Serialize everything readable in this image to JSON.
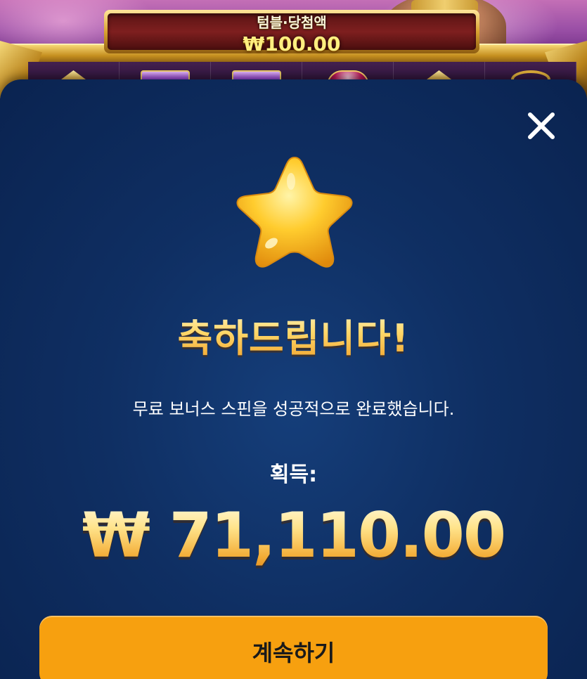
{
  "game": {
    "tumble_label": "텀블·당첨액",
    "tumble_amount": "₩100.00"
  },
  "modal": {
    "close_icon": "close-icon",
    "star_icon": "star-icon",
    "headline": "축하드립니다!",
    "message": "무료 보너스 스핀을 성공적으로 완료했습니다.",
    "gain_label": "획득:",
    "amount": "₩ 71,110.00",
    "continue_label": "계속하기"
  },
  "colors": {
    "modal_bg": "#0f2f63",
    "accent_button": "#f7a00f",
    "gold_text": "#ffd86a"
  }
}
